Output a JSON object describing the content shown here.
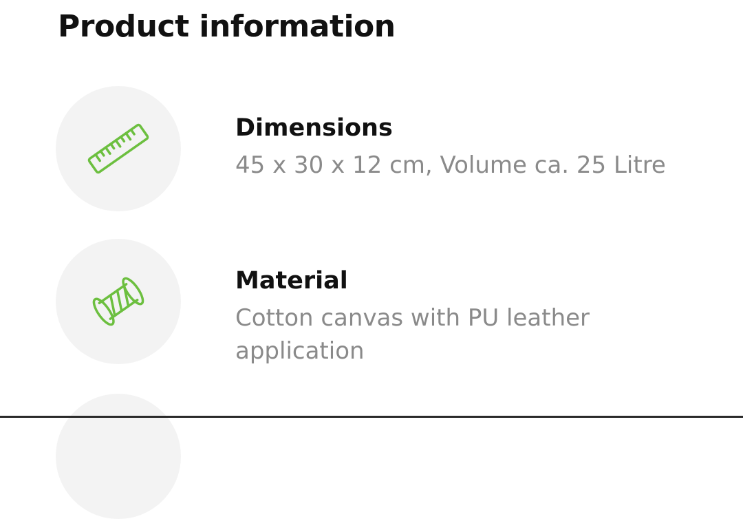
{
  "page": {
    "title": "Product information"
  },
  "items": [
    {
      "icon": "ruler-icon",
      "title": "Dimensions",
      "text": "45 x 30 x 12 cm, Volume ca. 25 Litre"
    },
    {
      "icon": "thread-spool-icon",
      "title": "Material",
      "text": "Cotton canvas with PU leather application"
    },
    {
      "icon": "",
      "title": "",
      "text": ""
    }
  ],
  "colors": {
    "accent": "#6cbf3f",
    "icon_background": "#f3f3f3",
    "secondary_text": "#8a8a8a",
    "primary_text": "#111111"
  }
}
